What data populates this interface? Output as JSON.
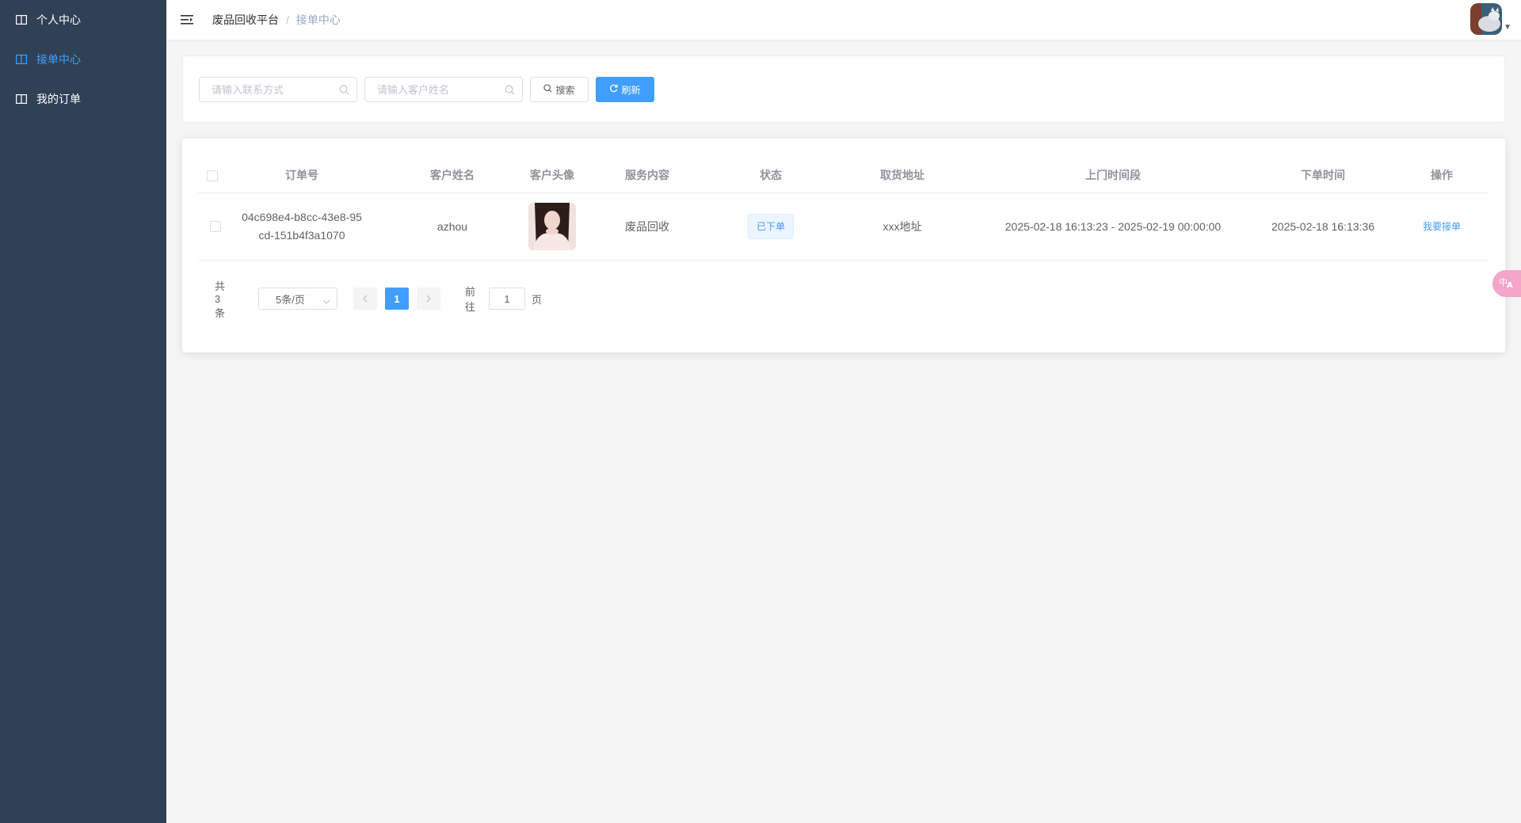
{
  "sidebar": {
    "items": [
      {
        "label": "个人中心",
        "active": false
      },
      {
        "label": "接单中心",
        "active": true
      },
      {
        "label": "我的订单",
        "active": false
      }
    ]
  },
  "header": {
    "breadcrumb": [
      "废品回收平台",
      "接单中心"
    ],
    "separator": "/"
  },
  "search": {
    "contact_placeholder": "请输入联系方式",
    "name_placeholder": "请输入客户姓名",
    "search_label": "搜索",
    "refresh_label": "刷新"
  },
  "table": {
    "columns": [
      "订单号",
      "客户姓名",
      "客户头像",
      "服务内容",
      "状态",
      "取货地址",
      "上门时间段",
      "下单时间",
      "操作"
    ],
    "rows": [
      {
        "order_no_line1": "04c698e4-b8cc-43e8-95",
        "order_no_line2": "cd-151b4f3a1070",
        "customer_name": "azhou",
        "service": "废品回收",
        "status": "已下单",
        "address": "xxx地址",
        "time_range": "2025-02-18 16:13:23 - 2025-02-19 00:00:00",
        "order_time": "2025-02-18 16:13:36",
        "action": "我要接单"
      }
    ]
  },
  "pagination": {
    "total": "共 3 条",
    "page_size": "5条/页",
    "current_page": "1",
    "goto_label": "前往",
    "goto_value": "1",
    "page_suffix": "页"
  },
  "colors": {
    "sidebar_bg": "#304156",
    "primary": "#409eff"
  },
  "icons": {
    "menu": "book-icon",
    "hamburger": "hamburger-icon",
    "search": "search-icon",
    "refresh": "refresh-icon",
    "translate": "translate-icon"
  }
}
